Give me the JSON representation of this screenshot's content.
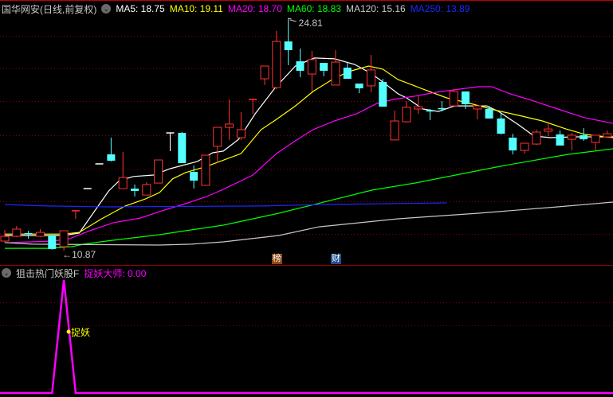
{
  "header": {
    "title": "国华网安(日线,前复权)",
    "ma": [
      {
        "label": "MA5: 18.75",
        "color": "#ffffff"
      },
      {
        "label": "MA10: 19.11",
        "color": "#ffff00"
      },
      {
        "label": "MA20: 18.70",
        "color": "#ff00ff"
      },
      {
        "label": "MA60: 18.83",
        "color": "#00ff00"
      },
      {
        "label": "MA120: 15.16",
        "color": "#c8c8c8"
      },
      {
        "label": "MA250: 13.89",
        "color": "#1e28ff"
      }
    ]
  },
  "annotations": {
    "high_label": "24.81",
    "low_label": "←10.87",
    "high_value": 24.81,
    "low_value": 10.87
  },
  "tags": [
    {
      "label": "榜",
      "color": "#8b4513",
      "index": 23
    },
    {
      "label": "财",
      "color": "#1e4f8c",
      "index": 28
    }
  ],
  "indicator": {
    "name": "狙击热门妖股F",
    "series_label": "捉妖大师: 0.00",
    "signal_label": "捉妖",
    "color": "#ff00ff",
    "levels": [
      60,
      80
    ],
    "range": [
      0,
      100
    ],
    "values_nonzero": [
      [
        5,
        100
      ]
    ],
    "count": 52
  },
  "colors": {
    "up": "#ff3232",
    "down": "#54ffff",
    "flat": "#ffffff",
    "grid": "#8b0000"
  },
  "chart_data": {
    "type": "candlestick",
    "ylim": [
      10.6,
      25.3
    ],
    "grid_levels": [
      24.0,
      22.0,
      20.0,
      17.9,
      15.9,
      13.9,
      11.9
    ],
    "candles": [
      [
        11.46,
        12.14,
        11.37,
        11.75,
        "up"
      ],
      [
        11.75,
        12.38,
        11.7,
        12.19,
        "up"
      ],
      [
        11.91,
        12.09,
        11.61,
        11.89,
        "down"
      ],
      [
        11.75,
        12.19,
        11.7,
        11.99,
        "up"
      ],
      [
        11.8,
        11.8,
        10.93,
        10.98,
        "down"
      ],
      [
        11.12,
        12.09,
        10.87,
        12.09,
        "up"
      ],
      [
        13.31,
        13.31,
        12.82,
        13.31,
        "up"
      ],
      [
        14.66,
        14.66,
        14.66,
        14.66,
        "flat"
      ],
      [
        16.17,
        16.17,
        16.17,
        16.17,
        "flat"
      ],
      [
        16.75,
        17.77,
        16.32,
        16.36,
        "down"
      ],
      [
        14.66,
        16.9,
        14.66,
        15.34,
        "up"
      ],
      [
        14.66,
        14.91,
        14.18,
        14.52,
        "down"
      ],
      [
        14.27,
        15.05,
        14.27,
        14.91,
        "up"
      ],
      [
        15.0,
        16.41,
        15.0,
        16.41,
        "up"
      ],
      [
        18.06,
        18.06,
        16.95,
        18.06,
        "flat"
      ],
      [
        18.06,
        18.11,
        16.22,
        16.22,
        "down"
      ],
      [
        15.68,
        16.07,
        14.66,
        15.15,
        "down"
      ],
      [
        14.86,
        16.7,
        14.86,
        16.7,
        "up"
      ],
      [
        17.24,
        18.4,
        16.22,
        18.4,
        "up"
      ],
      [
        18.4,
        20.1,
        17.63,
        18.6,
        "up"
      ],
      [
        17.77,
        19.32,
        17.63,
        18.26,
        "up"
      ],
      [
        20.1,
        20.1,
        19.23,
        20.1,
        "up"
      ],
      [
        21.36,
        22.14,
        20.98,
        22.14,
        "up"
      ],
      [
        20.83,
        24.28,
        20.73,
        23.64,
        "up"
      ],
      [
        23.64,
        24.81,
        22.19,
        23.11,
        "down"
      ],
      [
        22.43,
        23.21,
        21.46,
        21.85,
        "down"
      ],
      [
        21.65,
        23.06,
        20.59,
        22.53,
        "up"
      ],
      [
        22.33,
        22.33,
        21.51,
        21.85,
        "down"
      ],
      [
        20.98,
        23.11,
        20.98,
        22.38,
        "up"
      ],
      [
        22.04,
        22.33,
        21.36,
        21.36,
        "down"
      ],
      [
        21.07,
        21.07,
        20.49,
        20.78,
        "down"
      ],
      [
        20.93,
        22.82,
        20.54,
        21.9,
        "up"
      ],
      [
        21.17,
        21.36,
        19.66,
        19.66,
        "down"
      ],
      [
        17.63,
        19.42,
        17.63,
        18.79,
        "up"
      ],
      [
        18.74,
        20.0,
        18.69,
        19.62,
        "up"
      ],
      [
        19.52,
        20.3,
        19.23,
        19.66,
        "up"
      ],
      [
        19.4,
        19.52,
        18.84,
        19.37,
        "down"
      ],
      [
        19.54,
        20.0,
        19.37,
        19.52,
        "down"
      ],
      [
        19.71,
        20.73,
        19.71,
        20.59,
        "up"
      ],
      [
        20.59,
        20.59,
        19.52,
        19.81,
        "down"
      ],
      [
        19.52,
        19.71,
        18.89,
        19.71,
        "up"
      ],
      [
        19.52,
        19.71,
        18.94,
        18.94,
        "down"
      ],
      [
        18.94,
        19.23,
        17.97,
        18.01,
        "down"
      ],
      [
        17.77,
        18.01,
        16.75,
        16.99,
        "down"
      ],
      [
        16.99,
        17.43,
        16.8,
        17.43,
        "up"
      ],
      [
        17.38,
        18.26,
        17.33,
        18.11,
        "up"
      ],
      [
        18.16,
        18.74,
        17.87,
        18.3,
        "up"
      ],
      [
        17.97,
        18.21,
        17.29,
        17.29,
        "down"
      ],
      [
        17.67,
        18.06,
        16.99,
        17.92,
        "up"
      ],
      [
        17.92,
        18.35,
        17.58,
        17.67,
        "down"
      ],
      [
        17.48,
        17.92,
        16.99,
        17.92,
        "up"
      ],
      [
        17.82,
        18.21,
        17.82,
        18.01,
        "up"
      ]
    ],
    "ma_lines": [
      {
        "name": "MA5",
        "color": "#ffffff",
        "points": [
          [
            0,
            11.8
          ],
          [
            5,
            11.8
          ],
          [
            6.3,
            11.95
          ],
          [
            8.8,
            14.52
          ],
          [
            9.7,
            15.15
          ],
          [
            10.9,
            15.4
          ],
          [
            12.6,
            15.49
          ],
          [
            14,
            15.88
          ],
          [
            16.3,
            16.32
          ],
          [
            17.6,
            16.85
          ],
          [
            18.5,
            16.95
          ],
          [
            19.8,
            17.67
          ],
          [
            21.2,
            19.23
          ],
          [
            22.9,
            20.83
          ],
          [
            24.6,
            22.14
          ],
          [
            26.2,
            22.63
          ],
          [
            27.9,
            22.58
          ],
          [
            29.6,
            22.24
          ],
          [
            31,
            21.7
          ],
          [
            32,
            21.17
          ],
          [
            33.3,
            20.44
          ],
          [
            34,
            20.2
          ],
          [
            35.4,
            19.52
          ],
          [
            36.7,
            19.37
          ],
          [
            38.1,
            19.71
          ],
          [
            39.4,
            19.71
          ],
          [
            40.8,
            19.71
          ],
          [
            41.8,
            19.37
          ],
          [
            43.5,
            18.55
          ],
          [
            44.8,
            17.87
          ],
          [
            46.2,
            17.77
          ],
          [
            48.2,
            17.82
          ],
          [
            51.5,
            17.82
          ]
        ]
      },
      {
        "name": "MA10",
        "color": "#ffff00",
        "points": [
          [
            0,
            11.89
          ],
          [
            5,
            11.89
          ],
          [
            6.3,
            11.99
          ],
          [
            8.2,
            12.82
          ],
          [
            10.2,
            13.6
          ],
          [
            11.9,
            14.03
          ],
          [
            13.1,
            14.42
          ],
          [
            14.2,
            15.25
          ],
          [
            15.3,
            15.64
          ],
          [
            17.1,
            16.02
          ],
          [
            20,
            16.8
          ],
          [
            21.7,
            18.26
          ],
          [
            23,
            18.89
          ],
          [
            24.6,
            19.71
          ],
          [
            26.1,
            20.59
          ],
          [
            27.7,
            21.31
          ],
          [
            29.1,
            21.8
          ],
          [
            30.8,
            22.14
          ],
          [
            32,
            21.95
          ],
          [
            33.3,
            21.31
          ],
          [
            34.7,
            20.93
          ],
          [
            35.4,
            20.73
          ],
          [
            37.4,
            20.2
          ],
          [
            39.4,
            19.86
          ],
          [
            41.4,
            19.47
          ],
          [
            43.5,
            19.13
          ],
          [
            45.5,
            18.79
          ],
          [
            47.5,
            18.3
          ],
          [
            49.1,
            17.97
          ],
          [
            51.5,
            17.77
          ]
        ]
      },
      {
        "name": "MA20",
        "color": "#ff00ff",
        "points": [
          [
            0.5,
            11.37
          ],
          [
            4.1,
            11.46
          ],
          [
            5.5,
            11.61
          ],
          [
            7.2,
            12.09
          ],
          [
            9.2,
            12.58
          ],
          [
            11.5,
            12.87
          ],
          [
            13.1,
            13.26
          ],
          [
            15.3,
            13.74
          ],
          [
            17.1,
            14.18
          ],
          [
            18.5,
            14.62
          ],
          [
            21,
            15.49
          ],
          [
            23,
            16.8
          ],
          [
            24.6,
            17.58
          ],
          [
            26.1,
            18.26
          ],
          [
            27.9,
            18.79
          ],
          [
            29.8,
            19.23
          ],
          [
            31.5,
            19.86
          ],
          [
            32.9,
            20.1
          ],
          [
            34.7,
            20.3
          ],
          [
            36.5,
            20.54
          ],
          [
            38.5,
            20.73
          ],
          [
            40.1,
            20.88
          ],
          [
            41.2,
            20.88
          ],
          [
            42.8,
            20.44
          ],
          [
            44.8,
            20.0
          ],
          [
            46.8,
            19.52
          ],
          [
            49.1,
            18.98
          ],
          [
            51.5,
            18.64
          ]
        ]
      },
      {
        "name": "MA60",
        "color": "#00ff00",
        "points": [
          [
            0,
            11.02
          ],
          [
            3.6,
            11.02
          ],
          [
            5.7,
            11.12
          ],
          [
            6.7,
            11.27
          ],
          [
            8.6,
            11.46
          ],
          [
            10.9,
            11.66
          ],
          [
            13.1,
            11.85
          ],
          [
            15.3,
            12.09
          ],
          [
            18.5,
            12.43
          ],
          [
            23.2,
            13.16
          ],
          [
            31.1,
            14.57
          ],
          [
            34.7,
            15.0
          ],
          [
            41.9,
            16.02
          ],
          [
            47.7,
            16.75
          ],
          [
            51.5,
            17.09
          ]
        ]
      },
      {
        "name": "MA120",
        "color": "#c8c8c8",
        "points": [
          [
            0,
            11.37
          ],
          [
            2.3,
            11.27
          ],
          [
            13.1,
            11.22
          ],
          [
            15.8,
            11.27
          ],
          [
            18.5,
            11.41
          ],
          [
            23.2,
            11.8
          ],
          [
            26.6,
            12.33
          ],
          [
            33.3,
            12.82
          ],
          [
            40.1,
            13.16
          ],
          [
            46.8,
            13.55
          ],
          [
            51.5,
            13.84
          ]
        ]
      },
      {
        "name": "MA250",
        "color": "#1e28ff",
        "points": [
          [
            0,
            13.69
          ],
          [
            3.6,
            13.6
          ],
          [
            8.6,
            13.55
          ],
          [
            21.9,
            13.6
          ],
          [
            26.6,
            13.69
          ],
          [
            37.4,
            13.79
          ]
        ]
      }
    ]
  }
}
